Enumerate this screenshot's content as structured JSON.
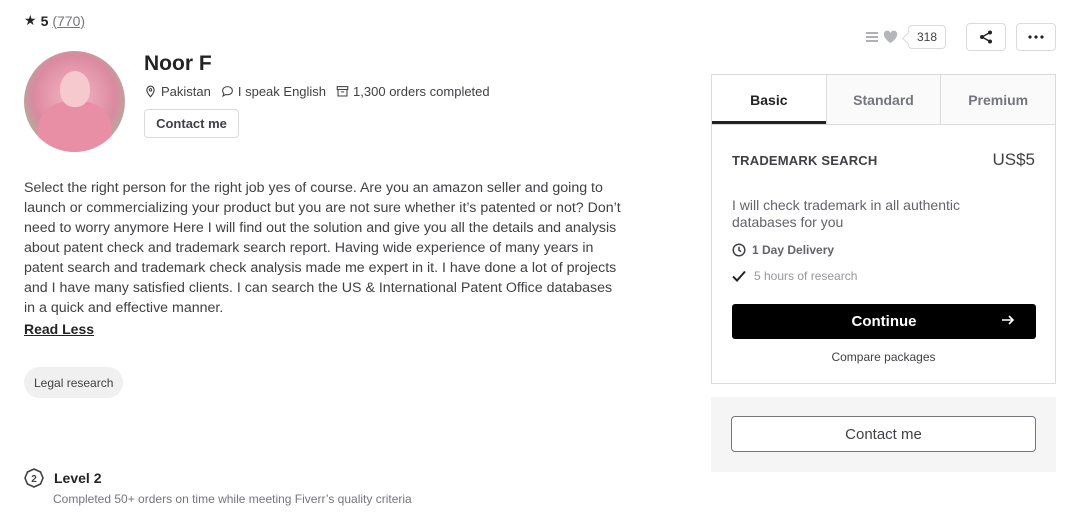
{
  "rating": {
    "score": "5",
    "count": "(770)"
  },
  "seller": {
    "name": "Noor F",
    "country": "Pakistan",
    "language": "I speak English",
    "orders": "1,300 orders completed",
    "contact_label": "Contact me"
  },
  "description": "Select the right person for the right job yes of course. Are you an amazon seller and going to launch or commercializing your product but you are not sure whether it’s patented or not? Don’t need to worry anymore Here I will find out the solution and give you all the details and analysis about patent check and trademark search report. Having wide experience of many years in patent search and trademark check analysis made me expert in it. I have done a lot of projects and I have many satisfied clients. I can search the US & International Patent Office databases in a quick and effective manner.",
  "read_less": "Read Less",
  "tag": "Legal research",
  "level": {
    "badge": "2",
    "title": "Level 2",
    "description": "Completed 50+ orders on time while meeting Fiverr’s quality criteria"
  },
  "actions": {
    "save_count": "318"
  },
  "package": {
    "tabs": [
      "Basic",
      "Standard",
      "Premium"
    ],
    "title": "TRADEMARK SEARCH",
    "price": "US$5",
    "description": "I will check trademark in all authentic databases for you",
    "delivery": "1 Day Delivery",
    "feature": "5 hours of research",
    "continue_label": "Continue",
    "compare_label": "Compare packages"
  },
  "contact_panel": {
    "label": "Contact me"
  },
  "colors": {
    "accent": "#000000",
    "text": "#404145",
    "muted": "#74767e"
  }
}
